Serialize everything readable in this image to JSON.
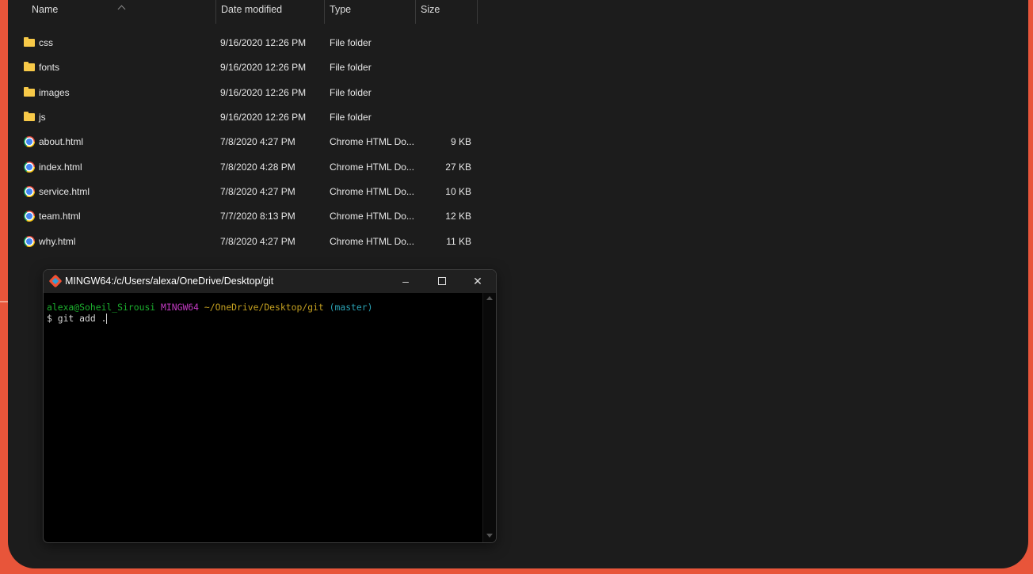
{
  "explorer": {
    "columns": {
      "name": "Name",
      "date": "Date modified",
      "type": "Type",
      "size": "Size"
    },
    "files": [
      {
        "name": "css",
        "date": "9/16/2020 12:26 PM",
        "type": "File folder",
        "size": "",
        "icon": "folder-icon"
      },
      {
        "name": "fonts",
        "date": "9/16/2020 12:26 PM",
        "type": "File folder",
        "size": "",
        "icon": "folder-icon"
      },
      {
        "name": "images",
        "date": "9/16/2020 12:26 PM",
        "type": "File folder",
        "size": "",
        "icon": "folder-icon"
      },
      {
        "name": "js",
        "date": "9/16/2020 12:26 PM",
        "type": "File folder",
        "size": "",
        "icon": "folder-icon"
      },
      {
        "name": "about.html",
        "date": "7/8/2020 4:27 PM",
        "type": "Chrome HTML Do...",
        "size": "9 KB",
        "icon": "chrome-icon"
      },
      {
        "name": "index.html",
        "date": "7/8/2020 4:28 PM",
        "type": "Chrome HTML Do...",
        "size": "27 KB",
        "icon": "chrome-icon"
      },
      {
        "name": "service.html",
        "date": "7/8/2020 4:27 PM",
        "type": "Chrome HTML Do...",
        "size": "10 KB",
        "icon": "chrome-icon"
      },
      {
        "name": "team.html",
        "date": "7/7/2020 8:13 PM",
        "type": "Chrome HTML Do...",
        "size": "12 KB",
        "icon": "chrome-icon"
      },
      {
        "name": "why.html",
        "date": "7/8/2020 4:27 PM",
        "type": "Chrome HTML Do...",
        "size": "11 KB",
        "icon": "chrome-icon"
      }
    ]
  },
  "terminal": {
    "title": "MINGW64:/c/Users/alexa/OneDrive/Desktop/git",
    "buttons": {
      "minimize": "–",
      "close": "✕"
    },
    "prompt": {
      "user_host": "alexa@Soheil_Sirousi",
      "shell": "MINGW64",
      "path": "~/OneDrive/Desktop/git",
      "branch": "(master)"
    },
    "command_prefix": "$",
    "command": "git add .",
    "colors": {
      "user_host": "#1cb02e",
      "shell": "#c23ac2",
      "path": "#c4a020",
      "branch": "#2aa1b3"
    }
  }
}
